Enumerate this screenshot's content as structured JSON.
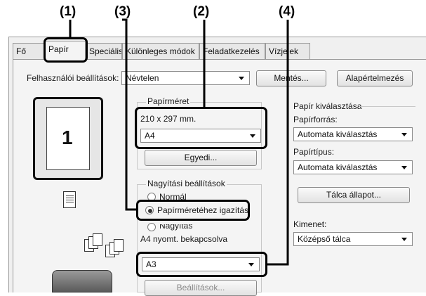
{
  "callouts": [
    "(1)",
    "(3)",
    "(2)",
    "(4)"
  ],
  "tabs": [
    "Fő",
    "Papír",
    "Speciális",
    "Különleges módok",
    "Feladatkezelés",
    "Vízjelek"
  ],
  "user_settings": {
    "label": "Felhasználói beállítások:",
    "value": "Névtelen",
    "save_button": "Mentés...",
    "default_button": "Alapértelmezés"
  },
  "preview": {
    "page_number": "1"
  },
  "paper_size": {
    "group_label": "Papírméret",
    "dimensions": "210 x 297 mm.",
    "value": "A4",
    "custom_button": "Egyedi..."
  },
  "zoom": {
    "group_label": "Nagyítási beállítások",
    "options": [
      "Normál",
      "Papírméretéhez igazítás",
      "Nagyítás"
    ],
    "selected_index": 1,
    "status_text": "A4 nyomt. bekapcsolva",
    "output_size": "A3",
    "settings_button": "Beállítások..."
  },
  "paper_selection": {
    "group_label": "Papír kiválasztása",
    "source_label": "Papírforrás:",
    "source_value": "Automata kiválasztás",
    "type_label": "Papírtípus:",
    "type_value": "Automata kiválasztás",
    "tray_button": "Tálca állapot..."
  },
  "output": {
    "label": "Kimenet:",
    "value": "Középső tálca"
  }
}
